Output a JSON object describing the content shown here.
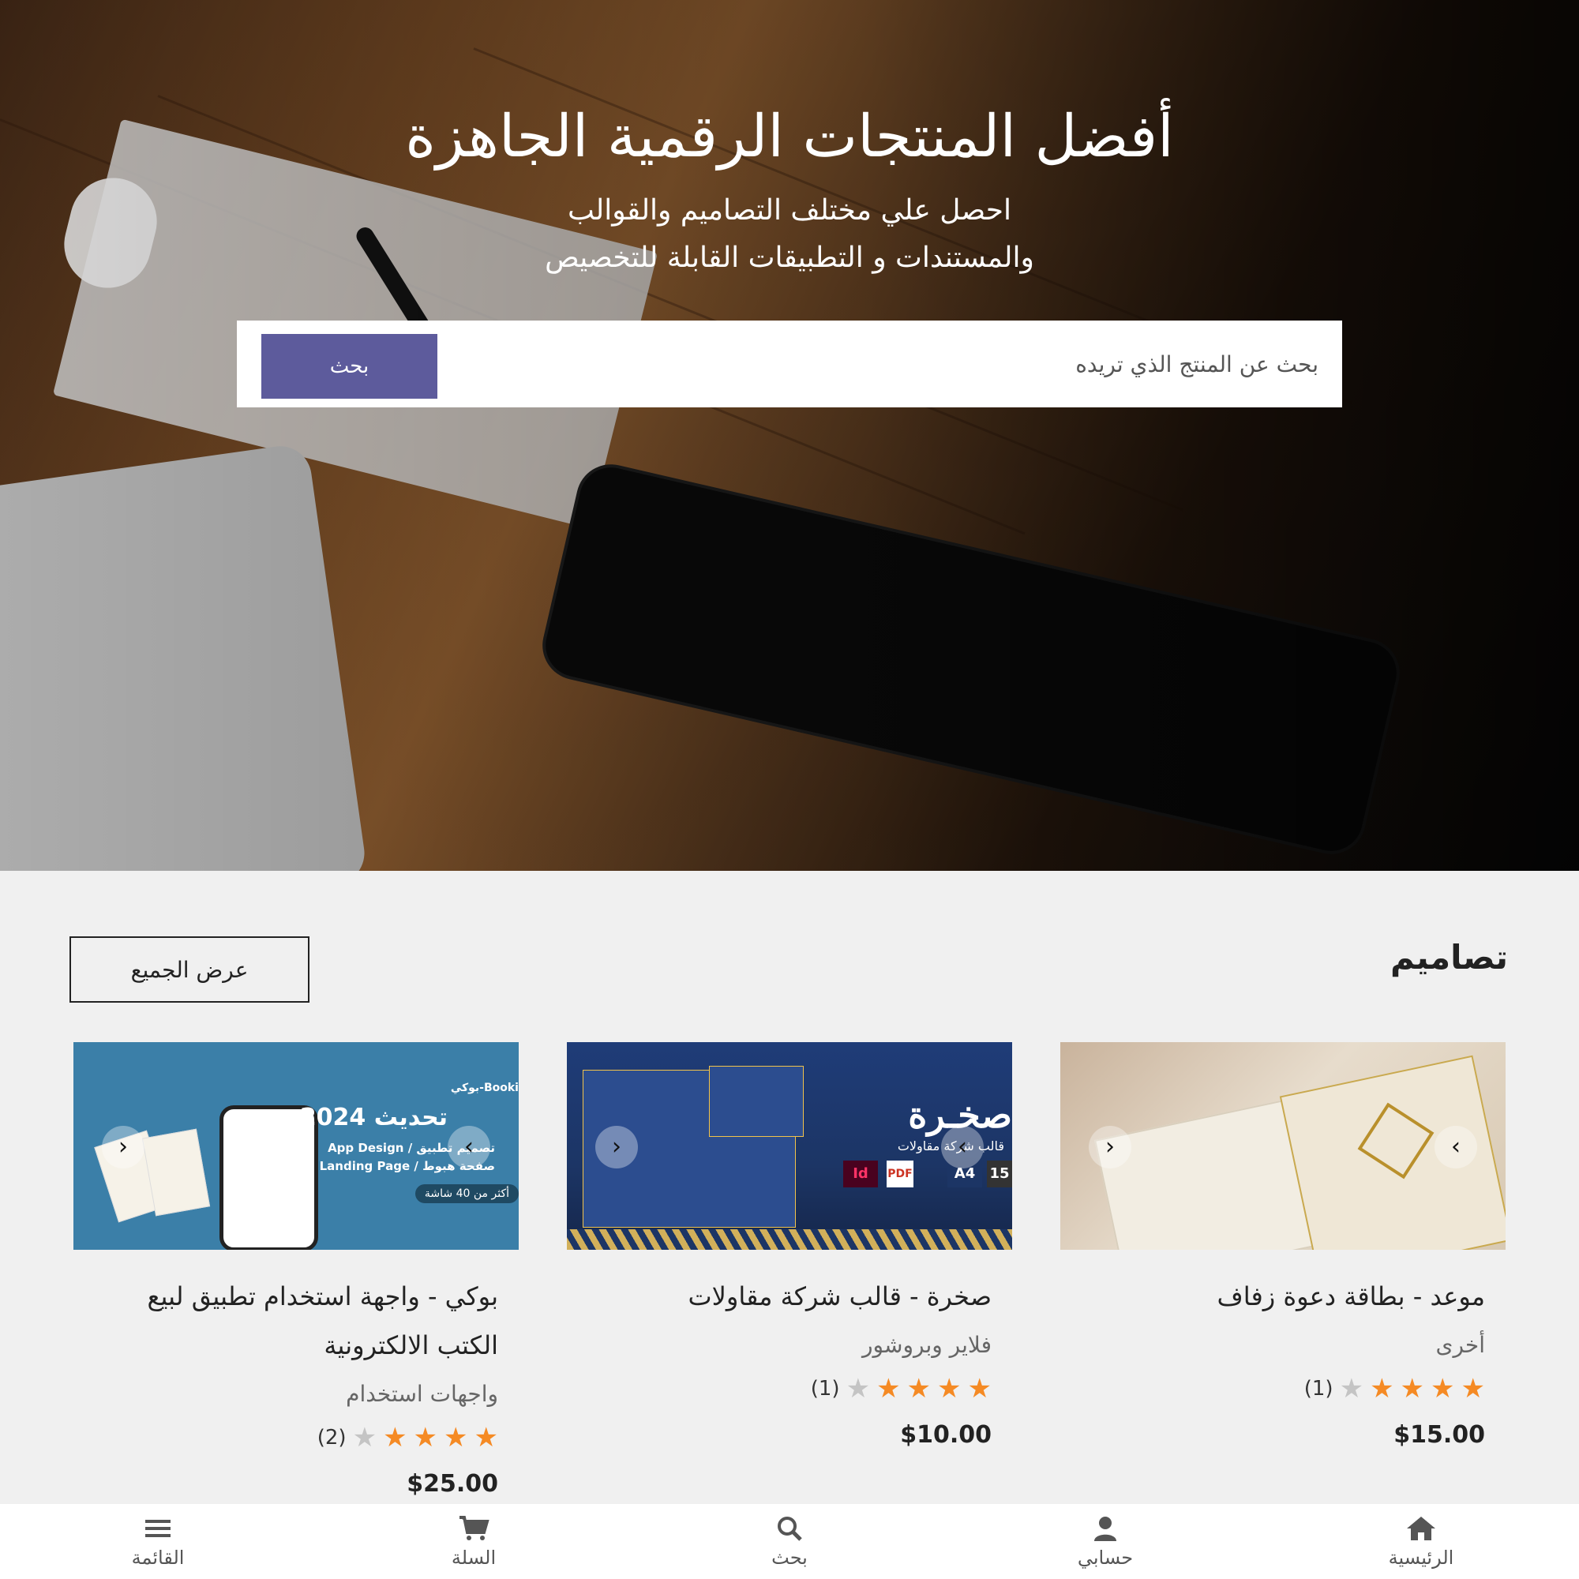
{
  "hero": {
    "title": "أفضل المنتجات الرقمية الجاهزة",
    "subtitle_line1": "احصل علي مختلف التصاميم والقوالب",
    "subtitle_line2": "والمستندات و التطبيقات القابلة للتخصيص"
  },
  "search": {
    "placeholder": "بحث عن المنتج الذي تريده",
    "button_label": "بحث"
  },
  "section": {
    "title": "تصاميم",
    "view_all_label": "عرض الجميع"
  },
  "products": [
    {
      "title": "موعد - بطاقة دعوة زفاف",
      "category": "أخرى",
      "rating": 4,
      "reviews": "(1)",
      "price": "$15.00"
    },
    {
      "title": "صخرة - قالب شركة مقاولات",
      "category": "فلاير وبروشور",
      "rating": 4,
      "reviews": "(1)",
      "price": "$10.00",
      "image_text": {
        "brand": "صخـرة",
        "sub": "قالب شركة مقاولات",
        "badge_a4": "A4",
        "badge_pages": "15",
        "badge_id": "Id"
      }
    },
    {
      "title": "بوكي - واجهة استخدام تطبيق لبيع الكتب الالكترونية",
      "category": "واجهات استخدام",
      "rating": 4,
      "reviews": "(2)",
      "price": "$25.00",
      "image_text": {
        "brand": "Booki-بوكي",
        "year": "تحديث 2024",
        "line1": "App Design / تصميم تطبيق",
        "line2": "Landing Page / صفحة هبوط",
        "pill": "أكثر من 40 شاشة"
      }
    }
  ],
  "bottom_nav": [
    {
      "label": "الرئيسية",
      "icon": "home-icon"
    },
    {
      "label": "حسابي",
      "icon": "user-icon"
    },
    {
      "label": "بحث",
      "icon": "search-icon"
    },
    {
      "label": "السلة",
      "icon": "cart-icon"
    },
    {
      "label": "القائمة",
      "icon": "menu-icon"
    }
  ],
  "colors": {
    "accent": "#5d5b9c",
    "star": "#f58a24",
    "star_off": "#c4c4c4"
  }
}
